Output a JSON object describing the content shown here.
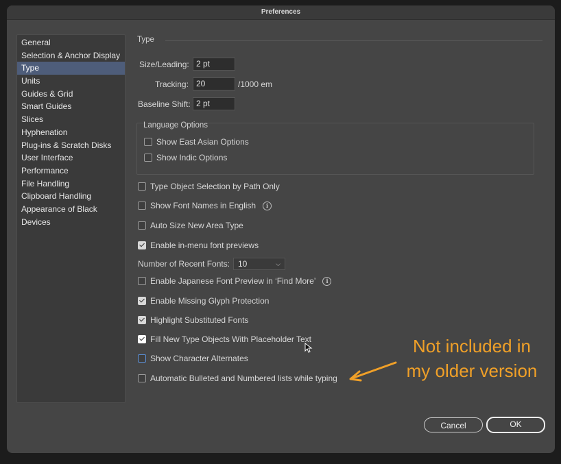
{
  "window": {
    "title": "Preferences"
  },
  "sidebar": {
    "items": [
      {
        "label": "General",
        "selected": false
      },
      {
        "label": "Selection & Anchor Display",
        "selected": false
      },
      {
        "label": "Type",
        "selected": true
      },
      {
        "label": "Units",
        "selected": false
      },
      {
        "label": "Guides & Grid",
        "selected": false
      },
      {
        "label": "Smart Guides",
        "selected": false
      },
      {
        "label": "Slices",
        "selected": false
      },
      {
        "label": "Hyphenation",
        "selected": false
      },
      {
        "label": "Plug-ins & Scratch Disks",
        "selected": false
      },
      {
        "label": "User Interface",
        "selected": false
      },
      {
        "label": "Performance",
        "selected": false
      },
      {
        "label": "File Handling",
        "selected": false
      },
      {
        "label": "Clipboard Handling",
        "selected": false
      },
      {
        "label": "Appearance of Black",
        "selected": false
      },
      {
        "label": "Devices",
        "selected": false
      }
    ]
  },
  "type_panel": {
    "section_title": "Type",
    "size_leading": {
      "label": "Size/Leading:",
      "value": "2 pt"
    },
    "tracking": {
      "label": "Tracking:",
      "value": "20",
      "unit": "/1000 em"
    },
    "baseline_shift": {
      "label": "Baseline Shift:",
      "value": "2 pt"
    },
    "language_options": {
      "title": "Language Options",
      "east_asian": {
        "label": "Show East Asian Options",
        "checked": false
      },
      "indic": {
        "label": "Show Indic Options",
        "checked": false
      }
    },
    "type_object_selection": {
      "label": "Type Object Selection by Path Only",
      "checked": false
    },
    "font_names_english": {
      "label": "Show Font Names in English",
      "checked": false
    },
    "auto_size": {
      "label": "Auto Size New Area Type",
      "checked": false
    },
    "in_menu_previews": {
      "label": "Enable in-menu font previews",
      "checked": true
    },
    "recent_fonts": {
      "label": "Number of Recent Fonts:",
      "value": "10"
    },
    "japanese_preview": {
      "label": "Enable Japanese Font Preview in ‘Find More’",
      "checked": false
    },
    "missing_glyph": {
      "label": "Enable Missing Glyph Protection",
      "checked": true
    },
    "highlight_substituted": {
      "label": "Highlight Substituted Fonts",
      "checked": true
    },
    "placeholder_text": {
      "label": "Fill New Type Objects With Placeholder Text",
      "checked": true
    },
    "character_alternates": {
      "label": "Show Character Alternates",
      "checked": false
    },
    "auto_bullets": {
      "label": "Automatic Bulleted and Numbered lists while typing",
      "checked": false
    }
  },
  "buttons": {
    "cancel": "Cancel",
    "ok": "OK"
  },
  "annotation": {
    "text_line1": "Not included in",
    "text_line2": "my older version",
    "color": "#f0a028"
  },
  "icons": {
    "info": "info-icon",
    "chevron": "chevron-down-icon",
    "cursor": "mouse-pointer-icon",
    "arrow": "annotation-arrow-icon"
  }
}
